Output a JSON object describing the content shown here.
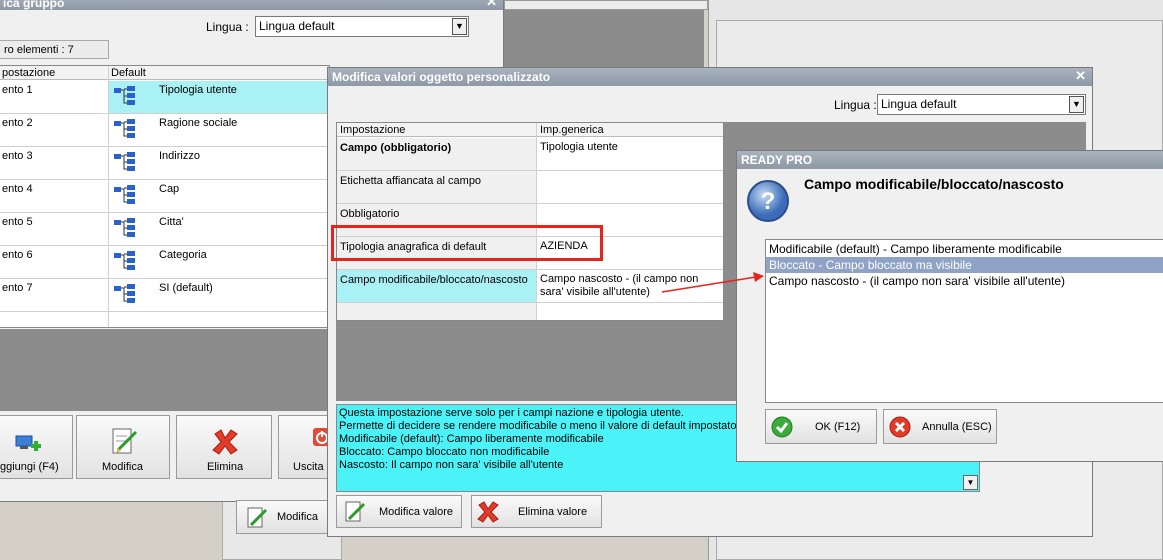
{
  "left_window": {
    "title": "ica gruppo",
    "lingua_label": "Lingua :",
    "lingua_value": "Lingua default",
    "elements_count": "ro elementi : 7",
    "col_setting": "postazione",
    "col_default": "Default",
    "rows": [
      {
        "name": "ento 1",
        "value": "Tipologia utente"
      },
      {
        "name": "ento 2",
        "value": "Ragione sociale"
      },
      {
        "name": "ento 3",
        "value": "Indirizzo"
      },
      {
        "name": "ento 4",
        "value": "Cap"
      },
      {
        "name": "ento 5",
        "value": "Citta'"
      },
      {
        "name": "ento 6",
        "value": "Categoria"
      },
      {
        "name": "ento 7",
        "value": "SI (default)"
      }
    ],
    "buttons": {
      "add": "ggiungi (F4)",
      "edit": "Modifica",
      "delete": "Elimina",
      "exit": "Uscita c"
    },
    "bottom_edit": "Modifica"
  },
  "mid_window": {
    "title": "Modifica valori oggetto personalizzato",
    "lingua_label": "Lingua :",
    "lingua_value": "Lingua default",
    "col_setting": "Impostazione",
    "col_value": "Imp.generica",
    "rows": [
      {
        "name": "Campo (obbligatorio)",
        "value": "Tipologia utente"
      },
      {
        "name": "Etichetta affiancata al campo",
        "value": ""
      },
      {
        "name": "Obbligatorio",
        "value": ""
      },
      {
        "name": "Tipologia anagrafica di default",
        "value": "AZIENDA"
      },
      {
        "name": "Campo modificabile/bloccato/nascosto",
        "value": "Campo nascosto - (il campo non sara' visibile all'utente)"
      }
    ],
    "info_lines": [
      "Questa impostazione serve solo per i campi nazione e tipologia utente.",
      "Permette di decidere se rendere modificabile o meno il valore di default impostato.",
      "Modificabile (default): Campo liberamente modificabile",
      "Bloccato: Campo bloccato non modificabile",
      "Nascosto: Il campo non sara' visibile all'utente"
    ],
    "btn_edit_value": "Modifica valore",
    "btn_delete_value": "Elimina valore"
  },
  "dialog": {
    "title": "READY PRO",
    "heading": "Campo modificabile/bloccato/nascosto",
    "options": [
      "Modificabile (default) - Campo liberamente modificabile",
      "Bloccato - Campo bloccato ma visibile",
      "Campo nascosto - (il campo non sara' visibile all'utente)"
    ],
    "selected_index": 1,
    "ok": "OK (F12)",
    "cancel": "Annulla (ESC)"
  },
  "colors": {
    "selection_cyan": "#aaf1f6",
    "highlight_red": "#e8231b",
    "list_selected": "#c7cfdc"
  }
}
